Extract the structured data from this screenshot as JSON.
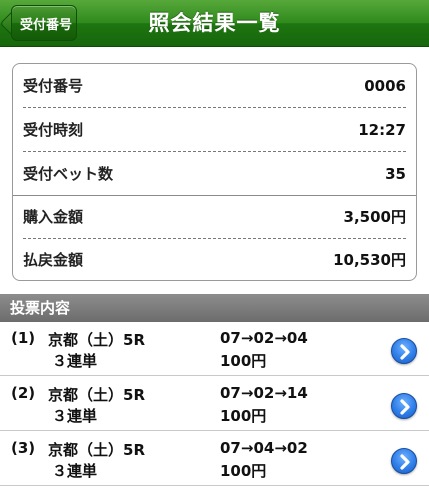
{
  "header": {
    "back_label": "受付番号",
    "title": "照会結果一覧"
  },
  "summary": {
    "rows": [
      {
        "label": "受付番号",
        "value": "0006"
      },
      {
        "label": "受付時刻",
        "value": "12:27"
      },
      {
        "label": "受付ベット数",
        "value": "35"
      },
      {
        "label": "購入金額",
        "value": "3,500円"
      },
      {
        "label": "払戻金額",
        "value": "10,530円"
      }
    ]
  },
  "votes": {
    "section_title": "投票内容",
    "items": [
      {
        "num": "(1)",
        "race": "京都（土）5R",
        "type": "３連単",
        "combo": "07→02→04",
        "amount": "100円",
        "icon": "chevron-right-icon"
      },
      {
        "num": "(2)",
        "race": "京都（土）5R",
        "type": "３連単",
        "combo": "07→02→14",
        "amount": "100円",
        "icon": "chevron-right-icon"
      },
      {
        "num": "(3)",
        "race": "京都（土）5R",
        "type": "３連単",
        "combo": "07→04→02",
        "amount": "100円",
        "icon": "chevron-right-icon"
      }
    ]
  },
  "colors": {
    "header_green": "#2f8a1c",
    "section_gray": "#7a7a7a",
    "arrow_blue": "#2f7ee8"
  }
}
